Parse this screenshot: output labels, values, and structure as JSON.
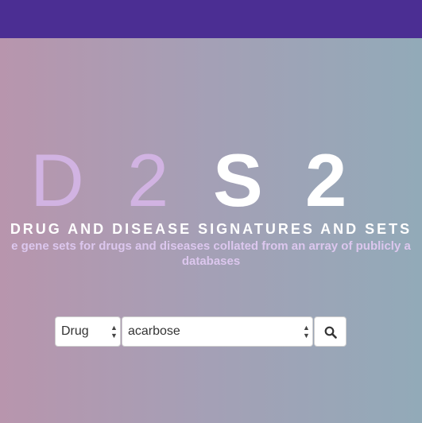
{
  "logo": {
    "letters": [
      "D",
      "2",
      "S",
      "2"
    ]
  },
  "tagline": "DRUG AND DISEASE SIGNATURES AND SETS",
  "subtitle": {
    "line1": "e gene sets for drugs and diseases collated from an array of publicly a",
    "line2": "databases"
  },
  "search": {
    "type_selected": "Drug",
    "query_value": "acarbose",
    "button_icon": "search-icon"
  },
  "colors": {
    "topbar": "#4b2e93",
    "logo_thin": "#d1b3e2",
    "logo_bold": "#ffffff"
  }
}
